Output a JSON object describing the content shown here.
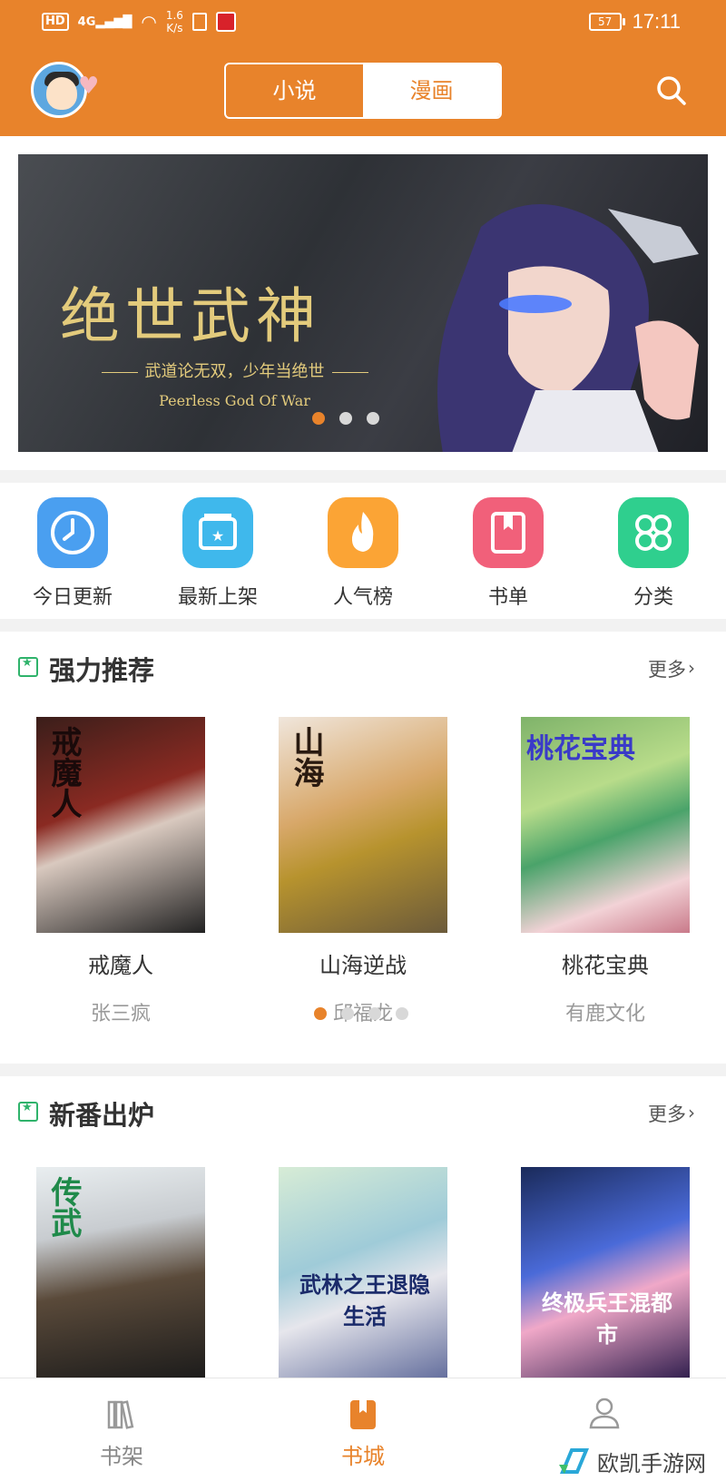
{
  "colors": {
    "accent": "#e8832b",
    "section_icon": "#2fb36b",
    "inactive_dot": "#d8d8d8"
  },
  "status_bar": {
    "hd": "HD",
    "network": "4G",
    "speed": [
      "1.6",
      "K/s"
    ],
    "battery": "57",
    "time": "17:11"
  },
  "header": {
    "tabs": [
      {
        "label": "小说",
        "active": false
      },
      {
        "label": "漫画",
        "active": true
      }
    ],
    "search_icon": "search-icon"
  },
  "banner": {
    "title": "绝世武神",
    "subtitle": "武道论无双，少年当绝世",
    "english": "Peerless God Of War",
    "dots": 3,
    "active_dot": 0
  },
  "categories": [
    {
      "label": "今日更新",
      "icon": "clock-icon",
      "color": "#4a9ff0"
    },
    {
      "label": "最新上架",
      "icon": "star-box-icon",
      "color": "#3fb8ec"
    },
    {
      "label": "人气榜",
      "icon": "flame-icon",
      "color": "#fba435"
    },
    {
      "label": "书单",
      "icon": "bookmark-book-icon",
      "color": "#f1607a"
    },
    {
      "label": "分类",
      "icon": "grid-icon",
      "color": "#2fcf8e"
    }
  ],
  "sections": [
    {
      "title": "强力推荐",
      "more": "更多",
      "books": [
        {
          "title": "戒魔人",
          "author": "张三疯",
          "cover_text": "戒魔人"
        },
        {
          "title": "山海逆战",
          "author": "邱福龙",
          "cover_text": "山海"
        },
        {
          "title": "桃花宝典",
          "author": "有鹿文化",
          "cover_text": "桃花宝典"
        }
      ],
      "dots": 4,
      "active_dot": 0
    },
    {
      "title": "新番出炉",
      "more": "更多",
      "books": [
        {
          "cover_text": "传武"
        },
        {
          "cover_text": "武林之王退隐生活"
        },
        {
          "cover_text": "终极兵王混都市"
        }
      ]
    }
  ],
  "bottom_nav": [
    {
      "label": "书架",
      "icon": "bookshelf-icon",
      "active": false
    },
    {
      "label": "书城",
      "icon": "bookstore-icon",
      "active": true
    },
    {
      "label": "",
      "icon": "user-icon",
      "active": false
    }
  ],
  "watermark": "欧凯手游网"
}
